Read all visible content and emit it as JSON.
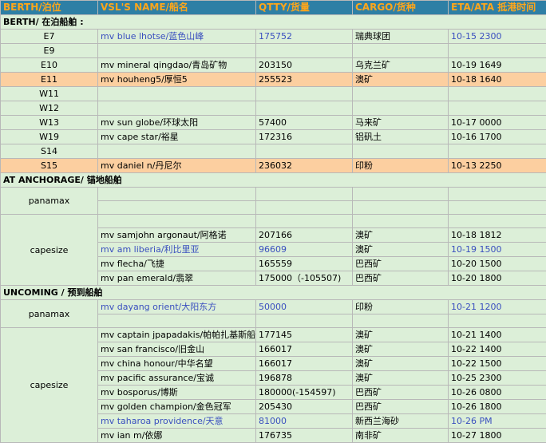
{
  "header": [
    "BERTH/泊位",
    "VSL'S NAME/船名",
    "QTTY/货量",
    "CARGO/货种",
    "ETA/ATA 抵港时间"
  ],
  "sections": {
    "berth": "BERTH/ 在泊船舶 :",
    "anchorage": "AT ANCHORAGE/ 锚地船舶",
    "incoming": "UNCOMING /  预到船舶"
  },
  "berth_rows": [
    {
      "berth": "E7",
      "vessel": "mv blue lhotse/蓝色山峰",
      "qty": "175752",
      "cargo": "瑞典球团",
      "eta": "10-15 2300",
      "blue": true
    },
    {
      "berth": "E9",
      "vessel": "",
      "qty": "",
      "cargo": "",
      "eta": ""
    },
    {
      "berth": "E10",
      "vessel": "mv mineral qingdao/青岛矿物",
      "qty": "203150",
      "cargo": "乌克兰矿",
      "eta": "10-19 1649"
    },
    {
      "berth": "E11",
      "vessel": "mv houheng5/厚恒5",
      "qty": "255523",
      "cargo": "澳矿",
      "eta": "10-18 1640",
      "highlight": true
    },
    {
      "berth": "W11",
      "vessel": "",
      "qty": "",
      "cargo": "",
      "eta": ""
    },
    {
      "berth": "W12",
      "vessel": "",
      "qty": "",
      "cargo": "",
      "eta": ""
    },
    {
      "berth": "W13",
      "vessel": "mv sun globe/环球太阳",
      "qty": "57400",
      "cargo": "马来矿",
      "eta": "10-17 0000"
    },
    {
      "berth": "W19",
      "vessel": "mv cape star/裕星",
      "qty": "172316",
      "cargo": "铝矾土",
      "eta": "10-16 1700"
    },
    {
      "berth": "S14",
      "vessel": "",
      "qty": "",
      "cargo": "",
      "eta": ""
    },
    {
      "berth": "S15",
      "vessel": "mv daniel n/丹尼尔",
      "qty": "236032",
      "cargo": "印粉",
      "eta": "10-13 2250",
      "highlight": true
    }
  ],
  "anchorage": {
    "panamax_label": "panamax",
    "capesize_label": "capesize",
    "capesize_rows": [
      {
        "vessel": "mv samjohn argonaut/阿格诺",
        "qty": "207166",
        "cargo": "澳矿",
        "eta": "10-18 1812"
      },
      {
        "vessel": "mv am liberia/利比里亚",
        "qty": "96609",
        "cargo": "澳矿",
        "eta": "10-19 1500",
        "blue": true
      },
      {
        "vessel": "mv flecha/飞捷",
        "qty": "165559",
        "cargo": "巴西矿",
        "eta": "10-20 1500"
      },
      {
        "vessel": "mv pan emerald/翡翠",
        "qty": "175000（-105507)",
        "cargo": "巴西矿",
        "eta": "10-20 1800"
      }
    ]
  },
  "incoming": {
    "panamax_label": "panamax",
    "panamax_row": {
      "vessel": "mv dayang orient/大阳东方",
      "qty": "50000",
      "cargo": "印粉",
      "eta": "10-21 1200",
      "blue": true
    },
    "capesize_label": "capesize",
    "capesize_rows": [
      {
        "vessel": "mv captain jpapadakis/帕帕扎基斯船",
        "qty": "177145",
        "cargo": "澳矿",
        "eta": "10-21 1400"
      },
      {
        "vessel": "mv san francisco/旧金山",
        "qty": "166017",
        "cargo": "澳矿",
        "eta": "10-22 1400"
      },
      {
        "vessel": "mv china honour/中华名望",
        "qty": "166017",
        "cargo": "澳矿",
        "eta": "10-22 1500"
      },
      {
        "vessel": "mv pacific assurance/宝诚",
        "qty": "196878",
        "cargo": "澳矿",
        "eta": "10-25 2300"
      },
      {
        "vessel": "mv bosporus/博斯",
        "qty": "180000(-154597)",
        "cargo": "巴西矿",
        "eta": "10-26 0800"
      },
      {
        "vessel": "mv golden champion/金色冠军",
        "qty": "205430",
        "cargo": "巴西矿",
        "eta": "10-26 1800"
      },
      {
        "vessel": "mv taharoa providence/天意",
        "qty": "81000",
        "cargo": "新西兰海砂",
        "eta": "10-26 PM",
        "blue": true
      },
      {
        "vessel": "mv ian m/依娜",
        "qty": "176735",
        "cargo": "南非矿",
        "eta": "10-27 1800"
      }
    ]
  }
}
